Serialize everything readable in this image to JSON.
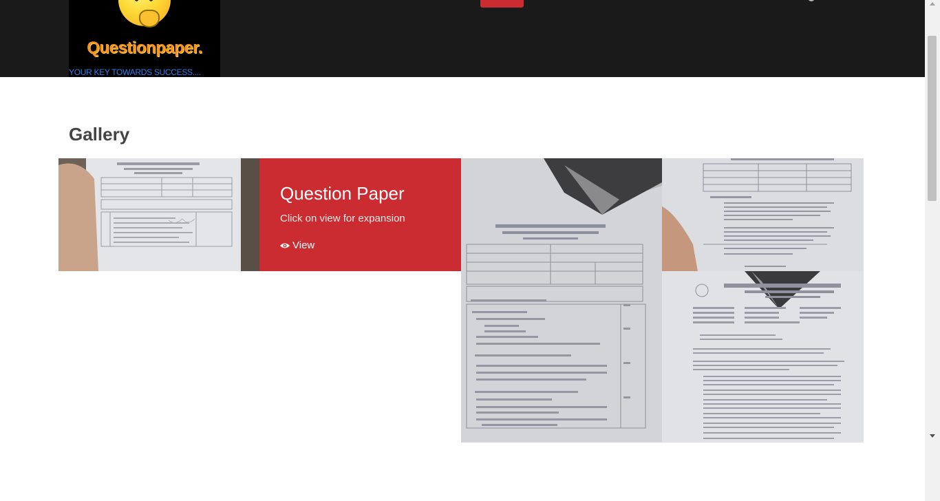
{
  "brand": {
    "logo_title": "Questionpaper.",
    "logo_tagline": "YOUR KEY TOWARDS SUCCESS....",
    "logo_icon": "thinking-smiley-icon"
  },
  "gallery": {
    "heading": "Gallery",
    "card": {
      "title": "Question Paper",
      "subtitle": "Click on view for expansion",
      "view_label": "View",
      "view_icon": "eye-icon"
    }
  },
  "colors": {
    "header_bg": "#1a1a1a",
    "accent_red": "#cb2c31",
    "logo_orange": "#f7941d",
    "tagline_blue": "#2f80ed"
  }
}
